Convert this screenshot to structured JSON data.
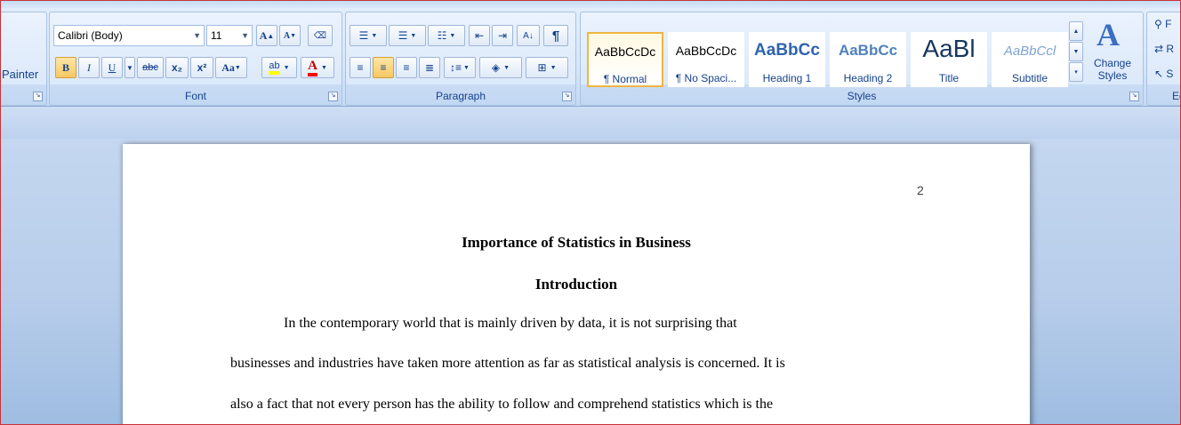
{
  "ribbon": {
    "clipboard": {
      "painter_label": "Painter"
    },
    "font": {
      "label": "Font",
      "family": "Calibri (Body)",
      "size": "11",
      "grow_label": "A",
      "shrink_label": "A",
      "bold": "B",
      "italic": "I",
      "underline": "U",
      "strike": "abc",
      "subscript": "x₂",
      "superscript": "x²",
      "change_case": "Aa",
      "highlight": "ab",
      "font_color": "A"
    },
    "paragraph": {
      "label": "Paragraph",
      "show_marks": "¶"
    },
    "styles": {
      "label": "Styles",
      "tiles": [
        {
          "sample": "AaBbCcDc",
          "name": "¶ Normal"
        },
        {
          "sample": "AaBbCcDc",
          "name": "¶ No Spaci..."
        },
        {
          "sample": "AaBbCc",
          "name": "Heading 1"
        },
        {
          "sample": "AaBbCc",
          "name": "Heading 2"
        },
        {
          "sample": "AaBl",
          "name": "Title"
        },
        {
          "sample": "AaBbCcl",
          "name": "Subtitle"
        }
      ],
      "change_styles": "Change Styles"
    },
    "editing": {
      "label": "Ed",
      "find": "F",
      "replace": "R",
      "select": "S"
    }
  },
  "document": {
    "page_number": "2",
    "title": "Importance of Statistics in Business",
    "heading": "Introduction",
    "lines": [
      "In the contemporary world that is mainly driven by data, it is not surprising  that",
      "businesses and industries have taken more attention as far as statistical analysis is concerned. It is",
      "also a fact that not every person has the ability to follow and comprehend statistics which is the"
    ]
  },
  "colors": {
    "ribbon_text": "#15428b",
    "highlight_yellow": "#ffff00",
    "font_color_red": "#ff0000",
    "selected_style_border": "#f0b540"
  }
}
